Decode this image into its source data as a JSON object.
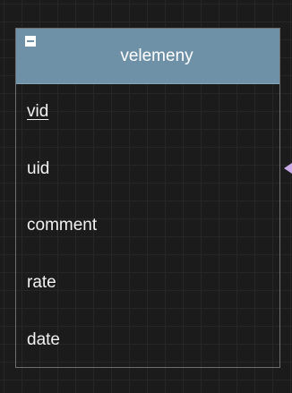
{
  "entity": {
    "title": "velemeny",
    "collapse_icon": "minus-square-icon",
    "header_color": "#6f91a8",
    "attributes": [
      {
        "name": "vid",
        "primary_key": true
      },
      {
        "name": "uid",
        "primary_key": false
      },
      {
        "name": "comment",
        "primary_key": false
      },
      {
        "name": "rate",
        "primary_key": false
      },
      {
        "name": "date",
        "primary_key": false
      }
    ]
  },
  "connector": {
    "icon": "arrow-left-icon",
    "color": "#c9a9e6"
  }
}
